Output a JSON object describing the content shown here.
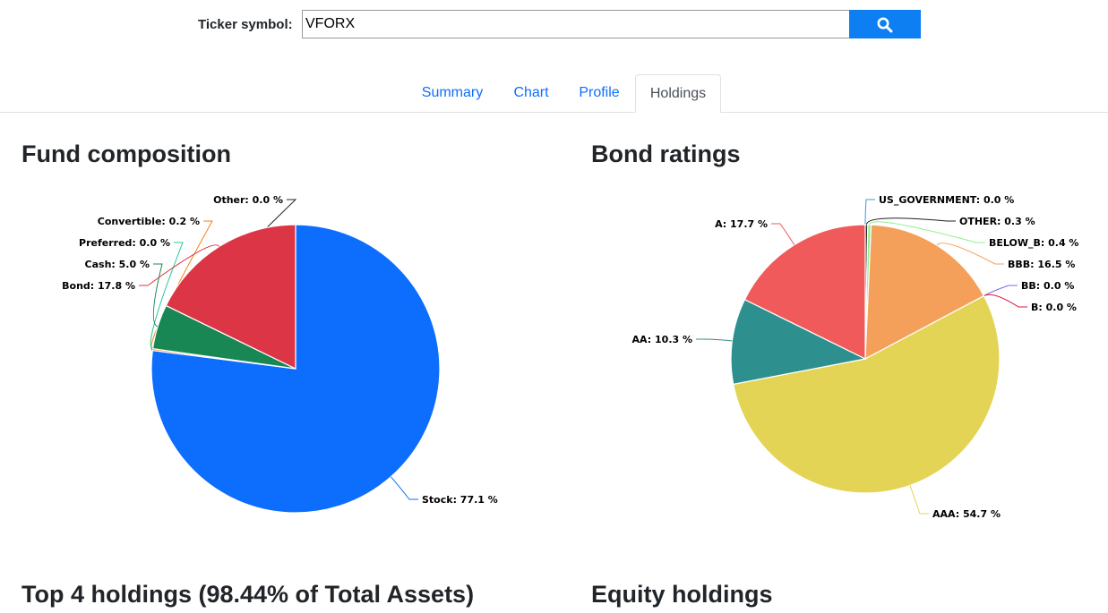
{
  "search": {
    "label": "Ticker symbol:",
    "value": "VFORX",
    "button_icon": "search-icon"
  },
  "tabs": [
    {
      "label": "Summary",
      "active": false
    },
    {
      "label": "Chart",
      "active": false
    },
    {
      "label": "Profile",
      "active": false
    },
    {
      "label": "Holdings",
      "active": true
    }
  ],
  "sections": {
    "fund_composition": "Fund composition",
    "bond_ratings": "Bond ratings",
    "top_holdings": "Top 4 holdings (98.44% of Total Assets)",
    "equity_holdings": "Equity holdings"
  },
  "chart_data": [
    {
      "type": "pie",
      "title": "Fund composition",
      "categories": [
        "Stock",
        "Bond",
        "Cash",
        "Preferred",
        "Convertible",
        "Other"
      ],
      "values": [
        77.1,
        17.8,
        5.0,
        0.0,
        0.2,
        0.0
      ],
      "labels": [
        "Stock: 77.1 %",
        "Bond: 17.8 %",
        "Cash: 5.0 %",
        "Preferred: 0.0 %",
        "Convertible: 0.2 %",
        "Other: 0.0 %"
      ],
      "colors": [
        "#0d6efd",
        "#dc3545",
        "#198754",
        "#20c997",
        "#fd7e14",
        "#212529"
      ]
    },
    {
      "type": "pie",
      "title": "Bond ratings",
      "categories": [
        "AAA",
        "AA",
        "A",
        "US_GOVERNMENT",
        "OTHER",
        "BELOW_B",
        "BBB",
        "BB",
        "B"
      ],
      "values": [
        54.7,
        10.3,
        17.7,
        0.0,
        0.3,
        0.4,
        16.5,
        0.0,
        0.0
      ],
      "labels": [
        "AAA: 54.7 %",
        "AA: 10.3 %",
        "A: 17.7 %",
        "US_GOVERNMENT: 0.0 %",
        "OTHER: 0.3 %",
        "BELOW_B: 0.4 %",
        "BBB: 16.5 %",
        "BB: 0.0 %",
        "B: 0.0 %"
      ],
      "colors": [
        "#e3d455",
        "#2e8f8f",
        "#f05a5a",
        "#3a9ad9",
        "#222222",
        "#90ee90",
        "#f5a05a",
        "#7b68ee",
        "#dc143c"
      ]
    }
  ]
}
